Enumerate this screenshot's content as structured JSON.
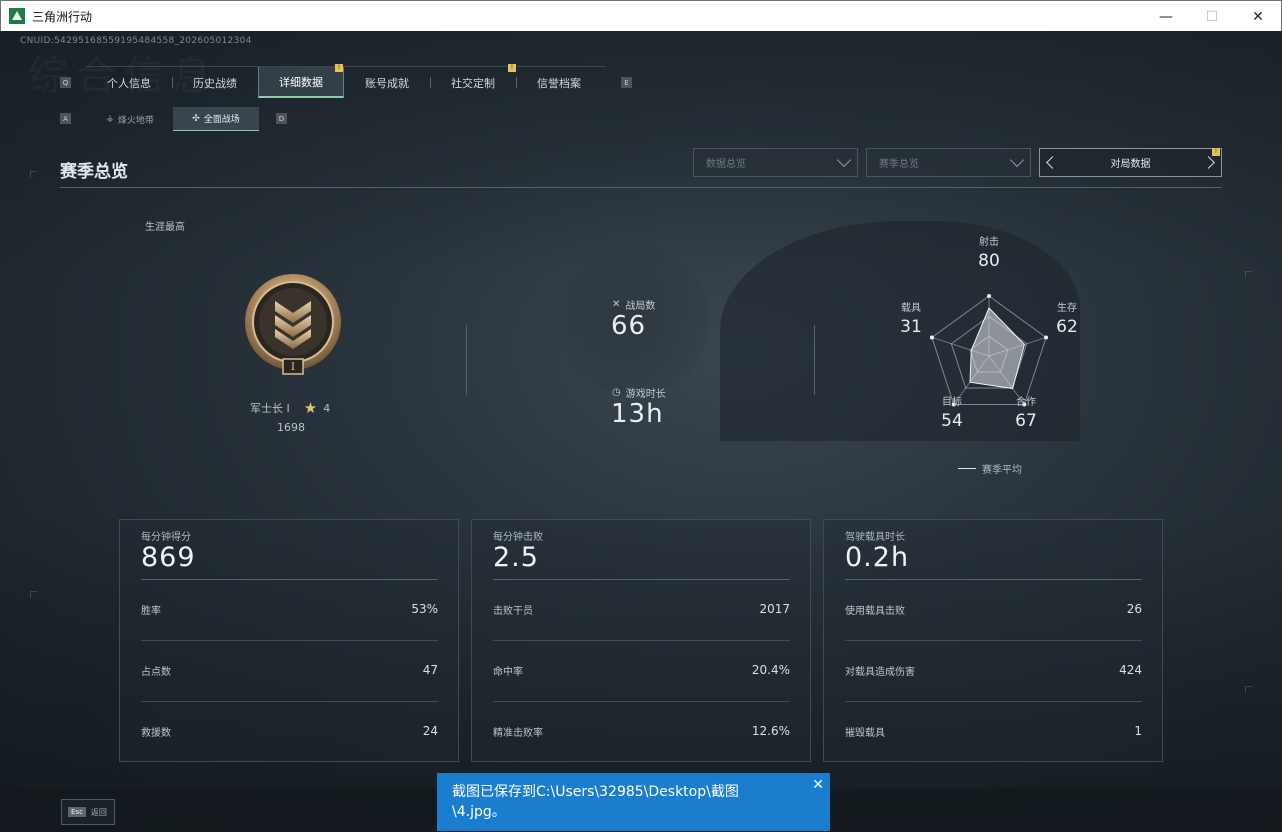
{
  "window": {
    "title": "三角洲行动",
    "minimize": "—",
    "maximize": "☐",
    "close": "✕"
  },
  "cnuid": "CNUID:54295168559195484558_202605012304",
  "background_text": "综合信息",
  "tabs": {
    "left_key": "Q",
    "right_key": "E",
    "items": [
      {
        "label": "个人信息"
      },
      {
        "label": "历史战绩"
      },
      {
        "label": "详细数据",
        "badge": "!"
      },
      {
        "label": "账号成就"
      },
      {
        "label": "社交定制",
        "badge": "!"
      },
      {
        "label": "信誉档案"
      }
    ]
  },
  "subtabs": {
    "left_key": "A",
    "right_key": "D",
    "items": [
      {
        "label": "烽火地带",
        "icon": "flame-icon"
      },
      {
        "label": "全面战场",
        "icon": "crosshair-icon"
      }
    ]
  },
  "section": {
    "title": "赛季总览",
    "dropdown1_placeholder": "数据总览",
    "dropdown2_placeholder": "赛季总览",
    "mode_label": "对局数据",
    "mode_badge": "!"
  },
  "career": {
    "label": "生涯最高",
    "rank_name": "军士长 I",
    "rank_numeral": "I",
    "stars": "4",
    "score": "1698"
  },
  "stats": {
    "matches_label": "战局数",
    "matches_value": "66",
    "playtime_label": "游戏时长",
    "playtime_value": "13h"
  },
  "radar": {
    "axes": [
      {
        "label": "射击",
        "value": "80"
      },
      {
        "label": "生存",
        "value": "62"
      },
      {
        "label": "合作",
        "value": "67"
      },
      {
        "label": "目标",
        "value": "54"
      },
      {
        "label": "载具",
        "value": "31"
      }
    ],
    "scores": [
      80,
      62,
      67,
      54,
      31
    ],
    "max": 100,
    "legend": "赛季平均"
  },
  "cards": [
    {
      "head_label": "每分钟得分",
      "head_value": "869",
      "rows": [
        {
          "label": "胜率",
          "value": "53%"
        },
        {
          "label": "占点数",
          "value": "47"
        },
        {
          "label": "救援数",
          "value": "24"
        }
      ]
    },
    {
      "head_label": "每分钟击败",
      "head_value": "2.5",
      "rows": [
        {
          "label": "击败干员",
          "value": "2017"
        },
        {
          "label": "命中率",
          "value": "20.4%"
        },
        {
          "label": "精准击败率",
          "value": "12.6%"
        }
      ]
    },
    {
      "head_label": "驾驶载具时长",
      "head_value": "0.2h",
      "rows": [
        {
          "label": "使用载具击败",
          "value": "26"
        },
        {
          "label": "对载具造成伤害",
          "value": "424"
        },
        {
          "label": "摧毁载具",
          "value": "1"
        }
      ]
    }
  ],
  "footer": {
    "esc_key": "Esc",
    "back_label": "返回"
  },
  "toast": {
    "message": "截图已保存到C:\\Users\\32985\\Desktop\\截图\\4.jpg。",
    "close": "✕"
  }
}
